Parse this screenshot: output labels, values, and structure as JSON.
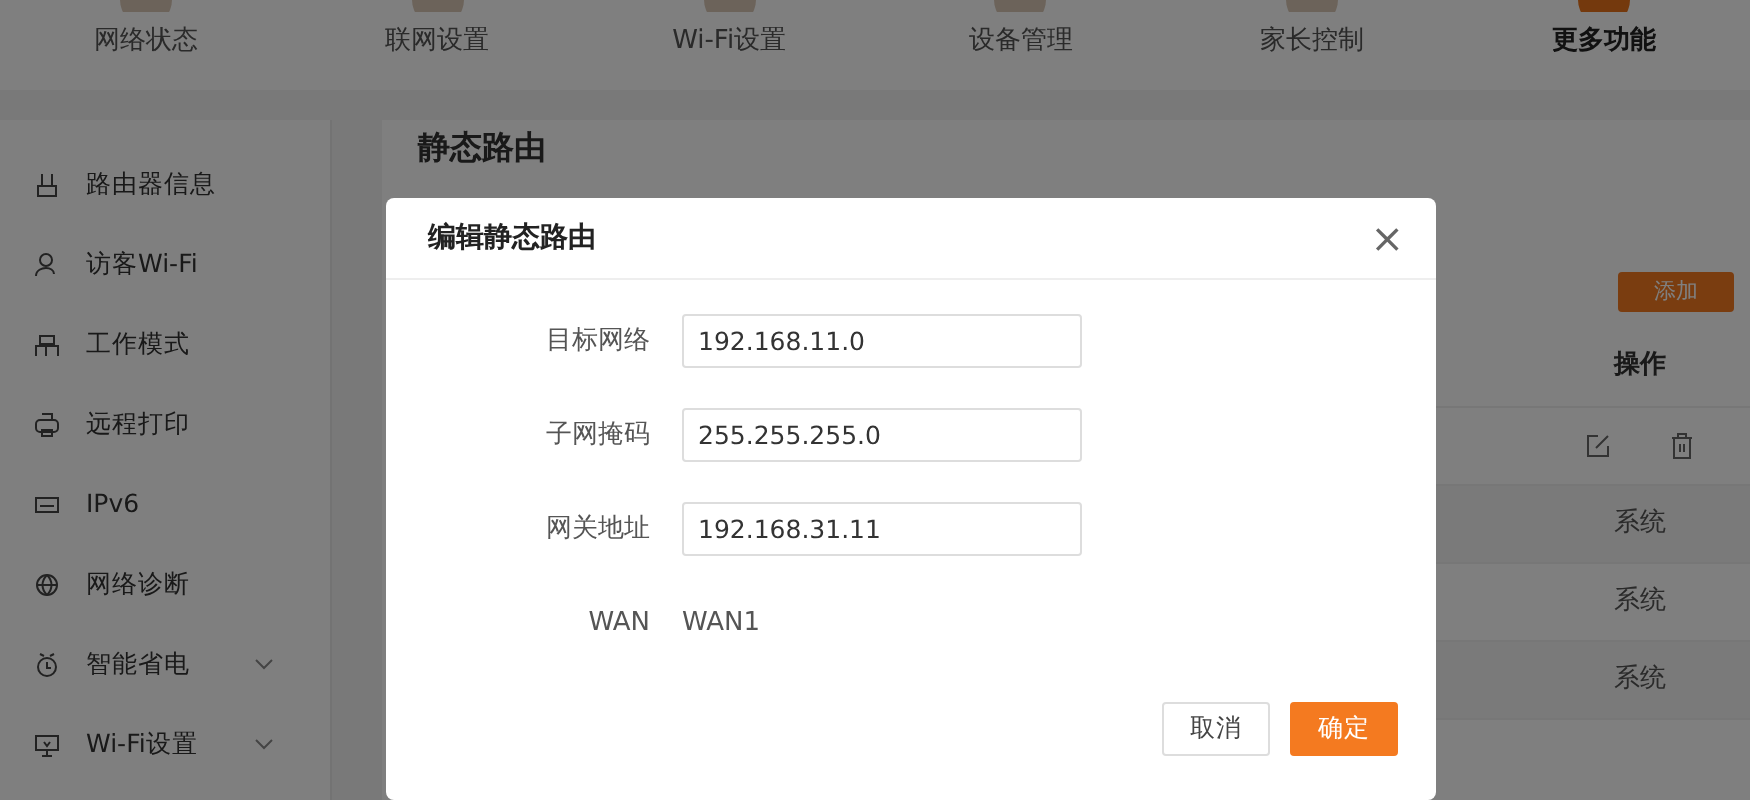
{
  "top_nav": [
    {
      "label": "网络状态",
      "selected": false
    },
    {
      "label": "联网设置",
      "selected": false
    },
    {
      "label": "Wi-Fi设置",
      "selected": false
    },
    {
      "label": "设备管理",
      "selected": false
    },
    {
      "label": "家长控制",
      "selected": false
    },
    {
      "label": "更多功能",
      "selected": true
    }
  ],
  "sidebar": {
    "items": [
      {
        "label": "路由器信息",
        "kind": "link"
      },
      {
        "label": "访客Wi-Fi",
        "kind": "link"
      },
      {
        "label": "工作模式",
        "kind": "link"
      },
      {
        "label": "远程打印",
        "kind": "link"
      },
      {
        "label": "IPv6",
        "kind": "link"
      },
      {
        "label": "网络诊断",
        "kind": "link"
      },
      {
        "label": "智能省电",
        "kind": "group"
      },
      {
        "label": "Wi-Fi设置",
        "kind": "group"
      }
    ]
  },
  "page": {
    "title": "静态路由",
    "add_button": "添加",
    "table": {
      "columns": [
        "操作"
      ],
      "rows": [
        {
          "kind": "actions"
        },
        {
          "kind": "text",
          "value": "系统"
        },
        {
          "kind": "text",
          "value": "系统"
        },
        {
          "kind": "text",
          "value": "系统"
        }
      ]
    }
  },
  "dialog": {
    "title": "编辑静态路由",
    "close": "×",
    "fields": [
      {
        "label": "目标网络",
        "kind": "input",
        "value": "192.168.11.0"
      },
      {
        "label": "子网掩码",
        "kind": "input",
        "value": "255.255.255.0"
      },
      {
        "label": "网关地址",
        "kind": "input",
        "value": "192.168.31.11"
      },
      {
        "label": "WAN",
        "kind": "static",
        "value": "WAN1"
      }
    ],
    "buttons": [
      {
        "label": "取消",
        "kind": "secondary"
      },
      {
        "label": "确定",
        "kind": "primary"
      }
    ]
  }
}
